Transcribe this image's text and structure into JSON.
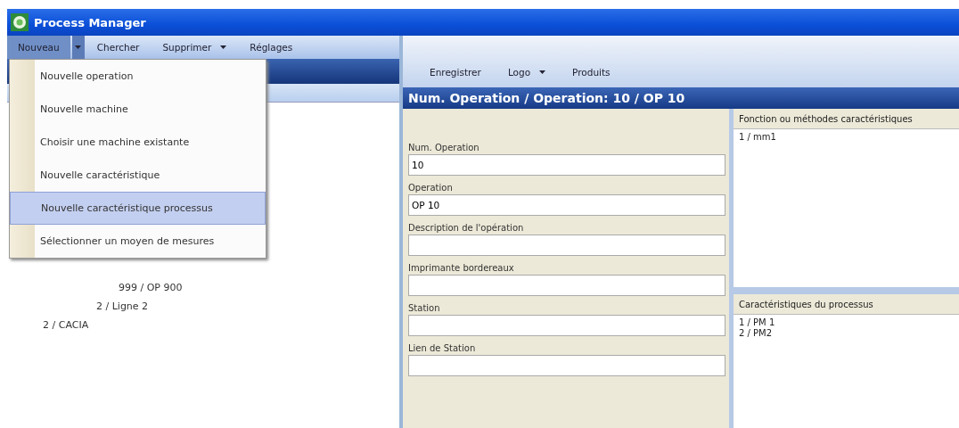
{
  "window": {
    "title": "Process Manager"
  },
  "left_toolbar": [
    {
      "label": "Nouveau",
      "kind": "split",
      "selected": true
    },
    {
      "label": "Chercher",
      "kind": "plain",
      "selected": false
    },
    {
      "label": "Supprimer",
      "kind": "dropdown",
      "selected": false
    },
    {
      "label": "Réglages",
      "kind": "plain",
      "selected": false
    }
  ],
  "menu": [
    {
      "label": "Nouvelle operation",
      "selected": false
    },
    {
      "label": "Nouvelle machine",
      "selected": false
    },
    {
      "label": "Choisir une machine existante",
      "selected": false
    },
    {
      "label": "Nouvelle caractéristique",
      "selected": false
    },
    {
      "label": "Nouvelle caractéristique processus",
      "selected": true
    },
    {
      "label": "Sélectionner un moyen de mesures",
      "selected": false
    }
  ],
  "tree": [
    {
      "label": "999 / OP 900"
    },
    {
      "label": "2 / Ligne 2"
    },
    {
      "label": "2 / CACIA"
    }
  ],
  "right_toolbar": [
    {
      "label": "Enregistrer",
      "kind": "plain"
    },
    {
      "label": "Logo",
      "kind": "dropdown"
    },
    {
      "label": "Produits",
      "kind": "plain"
    }
  ],
  "header": "Num. Operation / Operation: 10 / OP 10",
  "form": [
    {
      "label": "Num. Operation",
      "value": "10"
    },
    {
      "label": "Operation",
      "value": "OP 10"
    },
    {
      "label": "Description de l'opération"
    },
    {
      "label": "Imprimante bordereaux"
    },
    {
      "label": "Station"
    },
    {
      "label": "Lien de Station"
    }
  ],
  "panels": [
    {
      "title": "Fonction ou  méthodes caractéristiques",
      "items": [
        "1 / mm1"
      ]
    },
    {
      "title": "Caractéristiques du processus",
      "items": [
        "1 / PM 1",
        "2 / PM2"
      ]
    }
  ]
}
